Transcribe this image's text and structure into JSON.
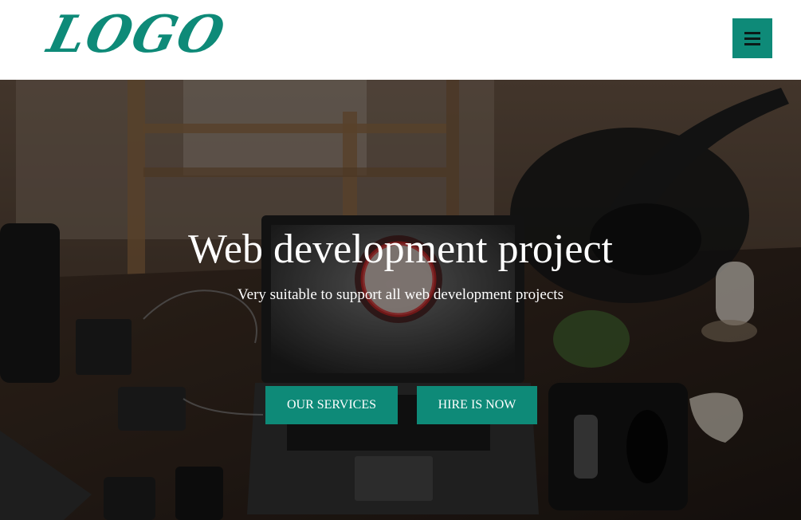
{
  "header": {
    "logo_text": "LOGO",
    "menu_icon": "hamburger-icon"
  },
  "hero": {
    "title": "Web development project",
    "subtitle": "Very suitable to support all web development projects",
    "buttons": {
      "services_label": "OUR SERVICES",
      "hire_label": "HIRE IS NOW"
    },
    "background_image": "desk with laptop, phones, lamp, plant and mouse"
  },
  "colors": {
    "accent": "#0e8a78",
    "header_bg": "#ffffff",
    "text_on_dark": "#ffffff"
  }
}
